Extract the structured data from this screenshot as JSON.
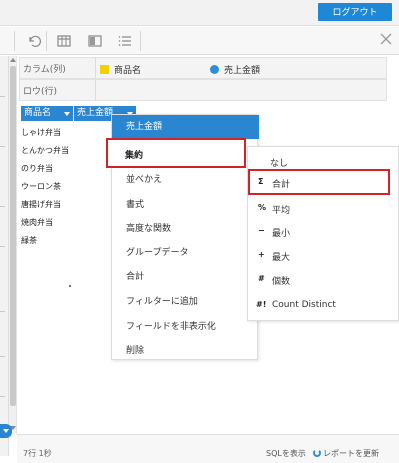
{
  "header": {
    "logout_label": "ログアウト"
  },
  "toolbar": {
    "icons": [
      "undo-icon",
      "table-icon",
      "layout-icon",
      "list-icon",
      "close-icon"
    ]
  },
  "shelves": {
    "column_label": "カラム(列)",
    "column_fields": [
      {
        "name": "商品名",
        "color": "#f3d000",
        "kind": "dimension"
      },
      {
        "name": "売上金額",
        "color": "#2e8fd8",
        "kind": "measure"
      }
    ],
    "row_label": "ロウ(行)"
  },
  "table": {
    "headers": [
      "商品名",
      "売上金額"
    ],
    "rows": [
      "しゃけ弁当",
      "とんかつ弁当",
      "のり弁当",
      "ウーロン茶",
      "唐揚げ弁当",
      "焼肉弁当",
      "緑茶"
    ]
  },
  "context_menu": {
    "title": "売上金額",
    "items": [
      "集約",
      "並べかえ",
      "書式",
      "高度な関数",
      "グループデータ",
      "合計",
      "フィルターに追加",
      "フィールドを非表示化",
      "削除"
    ],
    "highlighted": "集約"
  },
  "submenu": {
    "items": [
      {
        "symbol": "",
        "label": "なし"
      },
      {
        "symbol": "Σ",
        "label": "合計"
      },
      {
        "symbol": "%",
        "label": "平均"
      },
      {
        "symbol": "−",
        "label": "最小"
      },
      {
        "symbol": "+",
        "label": "最大"
      },
      {
        "symbol": "#",
        "label": "個数"
      },
      {
        "symbol": "#!",
        "label": "Count Distinct"
      }
    ],
    "highlighted": "合計"
  },
  "footer": {
    "status": "7行 1秒",
    "show_sql": "SQLを表示",
    "refresh": "レポートを更新"
  },
  "colors": {
    "accent": "#2a86d0",
    "highlight_border": "#d2222a",
    "dimension": "#f3d000",
    "measure": "#2e8fd8"
  }
}
